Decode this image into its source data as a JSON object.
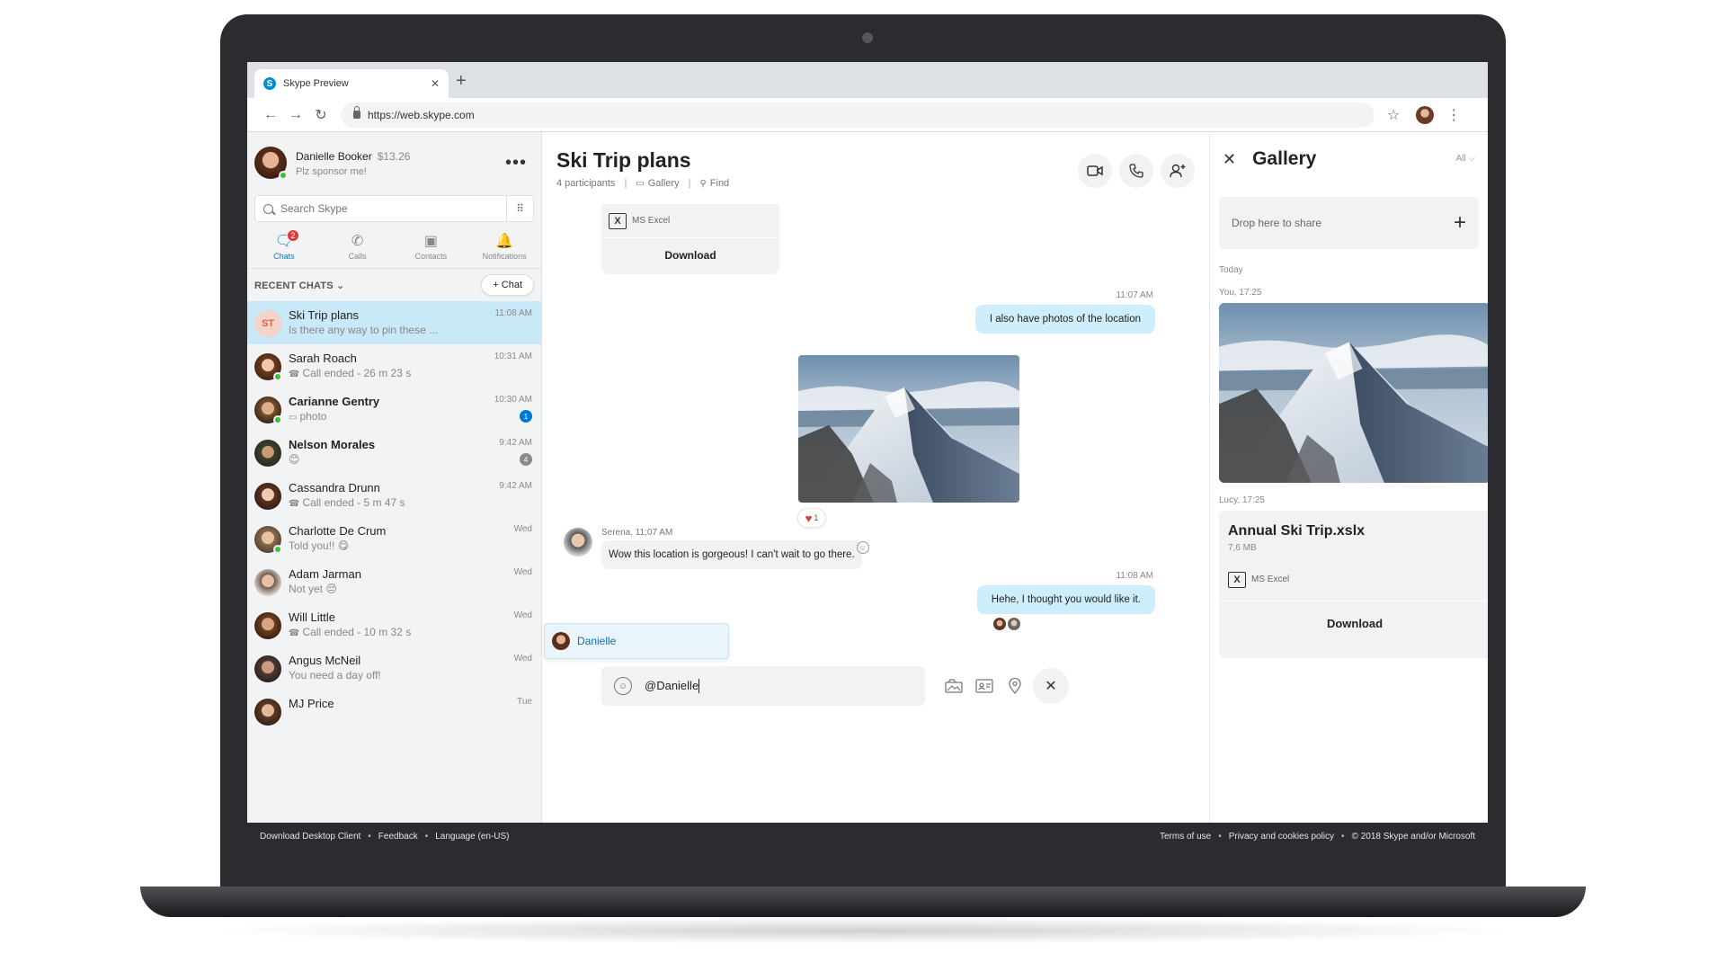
{
  "browser": {
    "tab_title": "Skype Preview",
    "tab_close": "✕",
    "new_tab": "+",
    "url": "https://web.skype.com",
    "back": "←",
    "forward": "→",
    "reload": "↻",
    "star": "☆",
    "menu": "⋮"
  },
  "profile": {
    "name": "Danielle Booker",
    "credit": "$13.26",
    "mood": "Plz sponsor me!",
    "more": "•••"
  },
  "search": {
    "placeholder": "Search Skype"
  },
  "nav": {
    "chats": "Chats",
    "chats_badge": "2",
    "calls": "Calls",
    "contacts": "Contacts",
    "notifications": "Notifications"
  },
  "recent": {
    "label": "RECENT CHATS ⌄",
    "new_chat": "+ Chat"
  },
  "chats": [
    {
      "initials": "ST",
      "name": "Ski Trip plans",
      "preview": "Is there any way to pin these ...",
      "time": "11:08 AM"
    },
    {
      "name": "Sarah Roach",
      "preview": "Call ended - 26 m 23 s",
      "time": "10:31 AM"
    },
    {
      "name": "Carianne Gentry",
      "preview": "photo",
      "time": "10:30 AM",
      "badge": "1"
    },
    {
      "name": "Nelson Morales",
      "preview": "😊",
      "time": "9:42 AM",
      "badge": "4"
    },
    {
      "name": "Cassandra Drunn",
      "preview": "Call ended - 5 m 47 s",
      "time": "9:42 AM"
    },
    {
      "name": "Charlotte De Crum",
      "preview": "Told you!! 😋",
      "time": "Wed"
    },
    {
      "name": "Adam Jarman",
      "preview": "Not yet 😔",
      "time": "Wed"
    },
    {
      "name": "Will Little",
      "preview": "Call ended - 10 m 32 s",
      "time": "Wed"
    },
    {
      "name": "Angus McNeil",
      "preview": "You need a day off!",
      "time": "Wed"
    },
    {
      "name": "MJ Price",
      "preview": "",
      "time": "Tue"
    }
  ],
  "conversation": {
    "title": "Ski Trip plans",
    "participants": "4 participants",
    "gallery_link": "Gallery",
    "find_link": "Find",
    "file_type": "MS Excel",
    "download": "Download",
    "time1": "11:07 AM",
    "msg_photos": "I also have photos of the location",
    "reaction_count": "1",
    "sender_line": "Serena, 11:07 AM",
    "msg_serena": "Wow this location is gorgeous! I can't wait to go there.",
    "time2": "11:08 AM",
    "msg_reply": "Hehe, I thought you would like it.",
    "mention": "Danielle",
    "composer_value": "@Danielle"
  },
  "gallery": {
    "title": "Gallery",
    "filter": "All ⌵",
    "drop_text": "Drop here to share",
    "section_today": "Today",
    "photo_meta": "You, 17:25",
    "file_meta": "Lucy, 17:25",
    "file_name": "Annual Ski Trip.xslx",
    "file_size": "7,6 MB",
    "file_type": "MS Excel",
    "download": "Download"
  },
  "footer": {
    "download_client": "Download Desktop Client",
    "feedback": "Feedback",
    "language": "Language (en-US)",
    "terms": "Terms of use",
    "privacy": "Privacy and cookies policy",
    "copyright": "© 2018 Skype and/or Microsoft"
  },
  "colors": {
    "accent": "#0078d4",
    "selected_chat": "#c9e8f8",
    "outgoing_bubble": "#cfeefc",
    "presence": "#3fbd3f",
    "badge_red": "#e0393e"
  }
}
